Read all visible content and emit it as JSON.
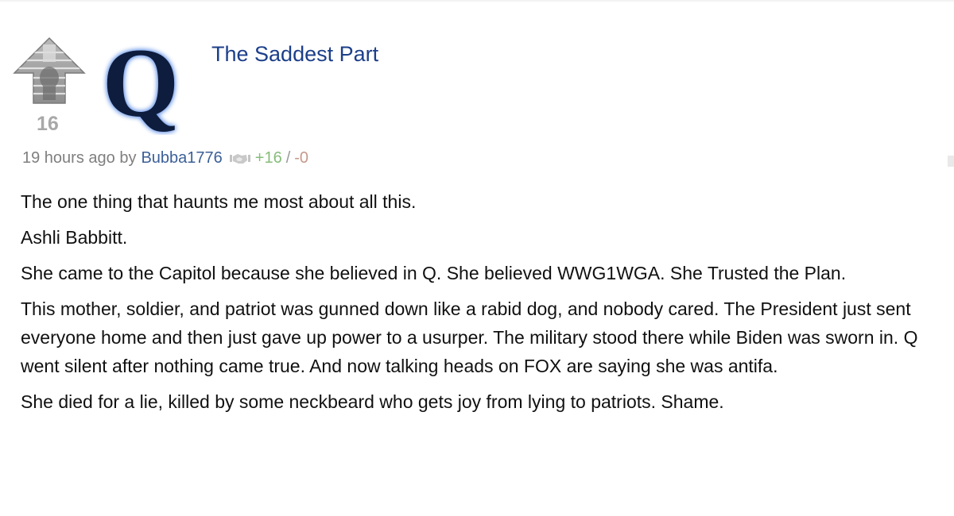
{
  "post": {
    "title": "The Saddest Part",
    "score": "16",
    "time_ago": "19 hours ago by",
    "author": "Bubba1776",
    "upvotes": "+16",
    "separator": "/",
    "downvotes": "-0"
  },
  "logo": {
    "letter": "Q",
    "color": "#0e1c3d",
    "glow": "#6a97e8"
  },
  "icons": {
    "upvote": "upvote-arrow-icon",
    "vote_counter": "handshake-icon"
  },
  "body": {
    "paragraphs": [
      "The one thing that haunts me most about all this.",
      "Ashli Babbitt.",
      "She came to the Capitol because she believed in Q. She believed WWG1WGA. She Trusted the Plan.",
      "This mother, soldier, and patriot was gunned down like a rabid dog, and nobody cared. The President just sent everyone home and then just gave up power to a usurper. The military stood there while Biden was sworn in. Q went silent after nothing came true. And now talking heads on FOX are saying she was antifa.",
      "She died for a lie, killed by some neckbeard who gets joy from lying to patriots. Shame."
    ]
  },
  "colors": {
    "title": "#1c3f8a",
    "author": "#3b5f97",
    "upvote_count": "#86bd7a",
    "downvote_count": "#c79a8c",
    "meta": "#7f7f7f",
    "score": "#a8a8a8"
  }
}
